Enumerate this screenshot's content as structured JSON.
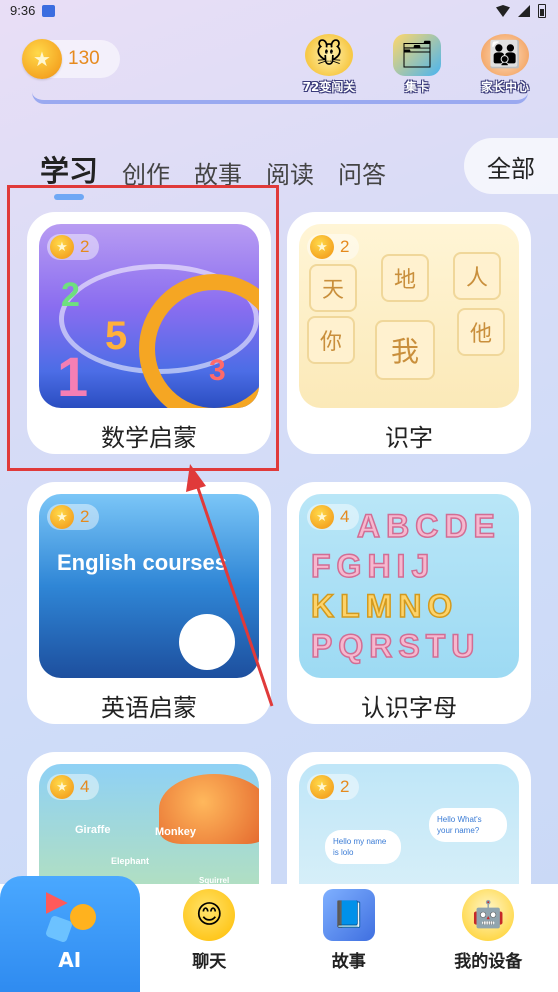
{
  "status_bar": {
    "time": "9:36"
  },
  "coins": {
    "count": "130"
  },
  "top_actions": [
    {
      "label": "72变闯关",
      "icon": "mouse-mascot-icon"
    },
    {
      "label": "集卡",
      "icon": "card-collection-icon"
    },
    {
      "label": "家长中心",
      "icon": "parents-icon"
    }
  ],
  "tabs": {
    "items": [
      "学习",
      "创作",
      "故事",
      "阅读",
      "问答"
    ],
    "active": "学习",
    "all_label": "全部"
  },
  "cards": [
    {
      "title": "数学启蒙",
      "cost": "2",
      "theme": "math"
    },
    {
      "title": "识字",
      "cost": "2",
      "theme": "chars",
      "tiles": [
        "天",
        "地",
        "人",
        "你",
        "我",
        "他"
      ]
    },
    {
      "title": "英语启蒙",
      "cost": "2",
      "theme": "english",
      "image_text": "English courses"
    },
    {
      "title": "认识字母",
      "cost": "4",
      "theme": "letters",
      "letter_rows": [
        "ABCDE",
        "FGHIJ",
        "KLMNO",
        "PQRSTU"
      ]
    },
    {
      "title": "",
      "cost": "4",
      "theme": "animals",
      "labels": [
        "Giraffe",
        "Monkey",
        "Elephant",
        "Squirrel"
      ]
    },
    {
      "title": "",
      "cost": "2",
      "theme": "conversation",
      "bubbles": [
        "Hello my name is lolo",
        "Hello What's your name?"
      ]
    }
  ],
  "bottom_nav": [
    {
      "label": "AI",
      "icon": "ai-shapes-icon",
      "active": true
    },
    {
      "label": "聊天",
      "icon": "chat-face-icon",
      "active": false
    },
    {
      "label": "故事",
      "icon": "story-book-icon",
      "active": false
    },
    {
      "label": "我的设备",
      "icon": "device-robot-icon",
      "active": false
    }
  ],
  "colors": {
    "accent": "#2f8bf0",
    "coin": "#f5a623",
    "highlight": "#e03a3a"
  }
}
